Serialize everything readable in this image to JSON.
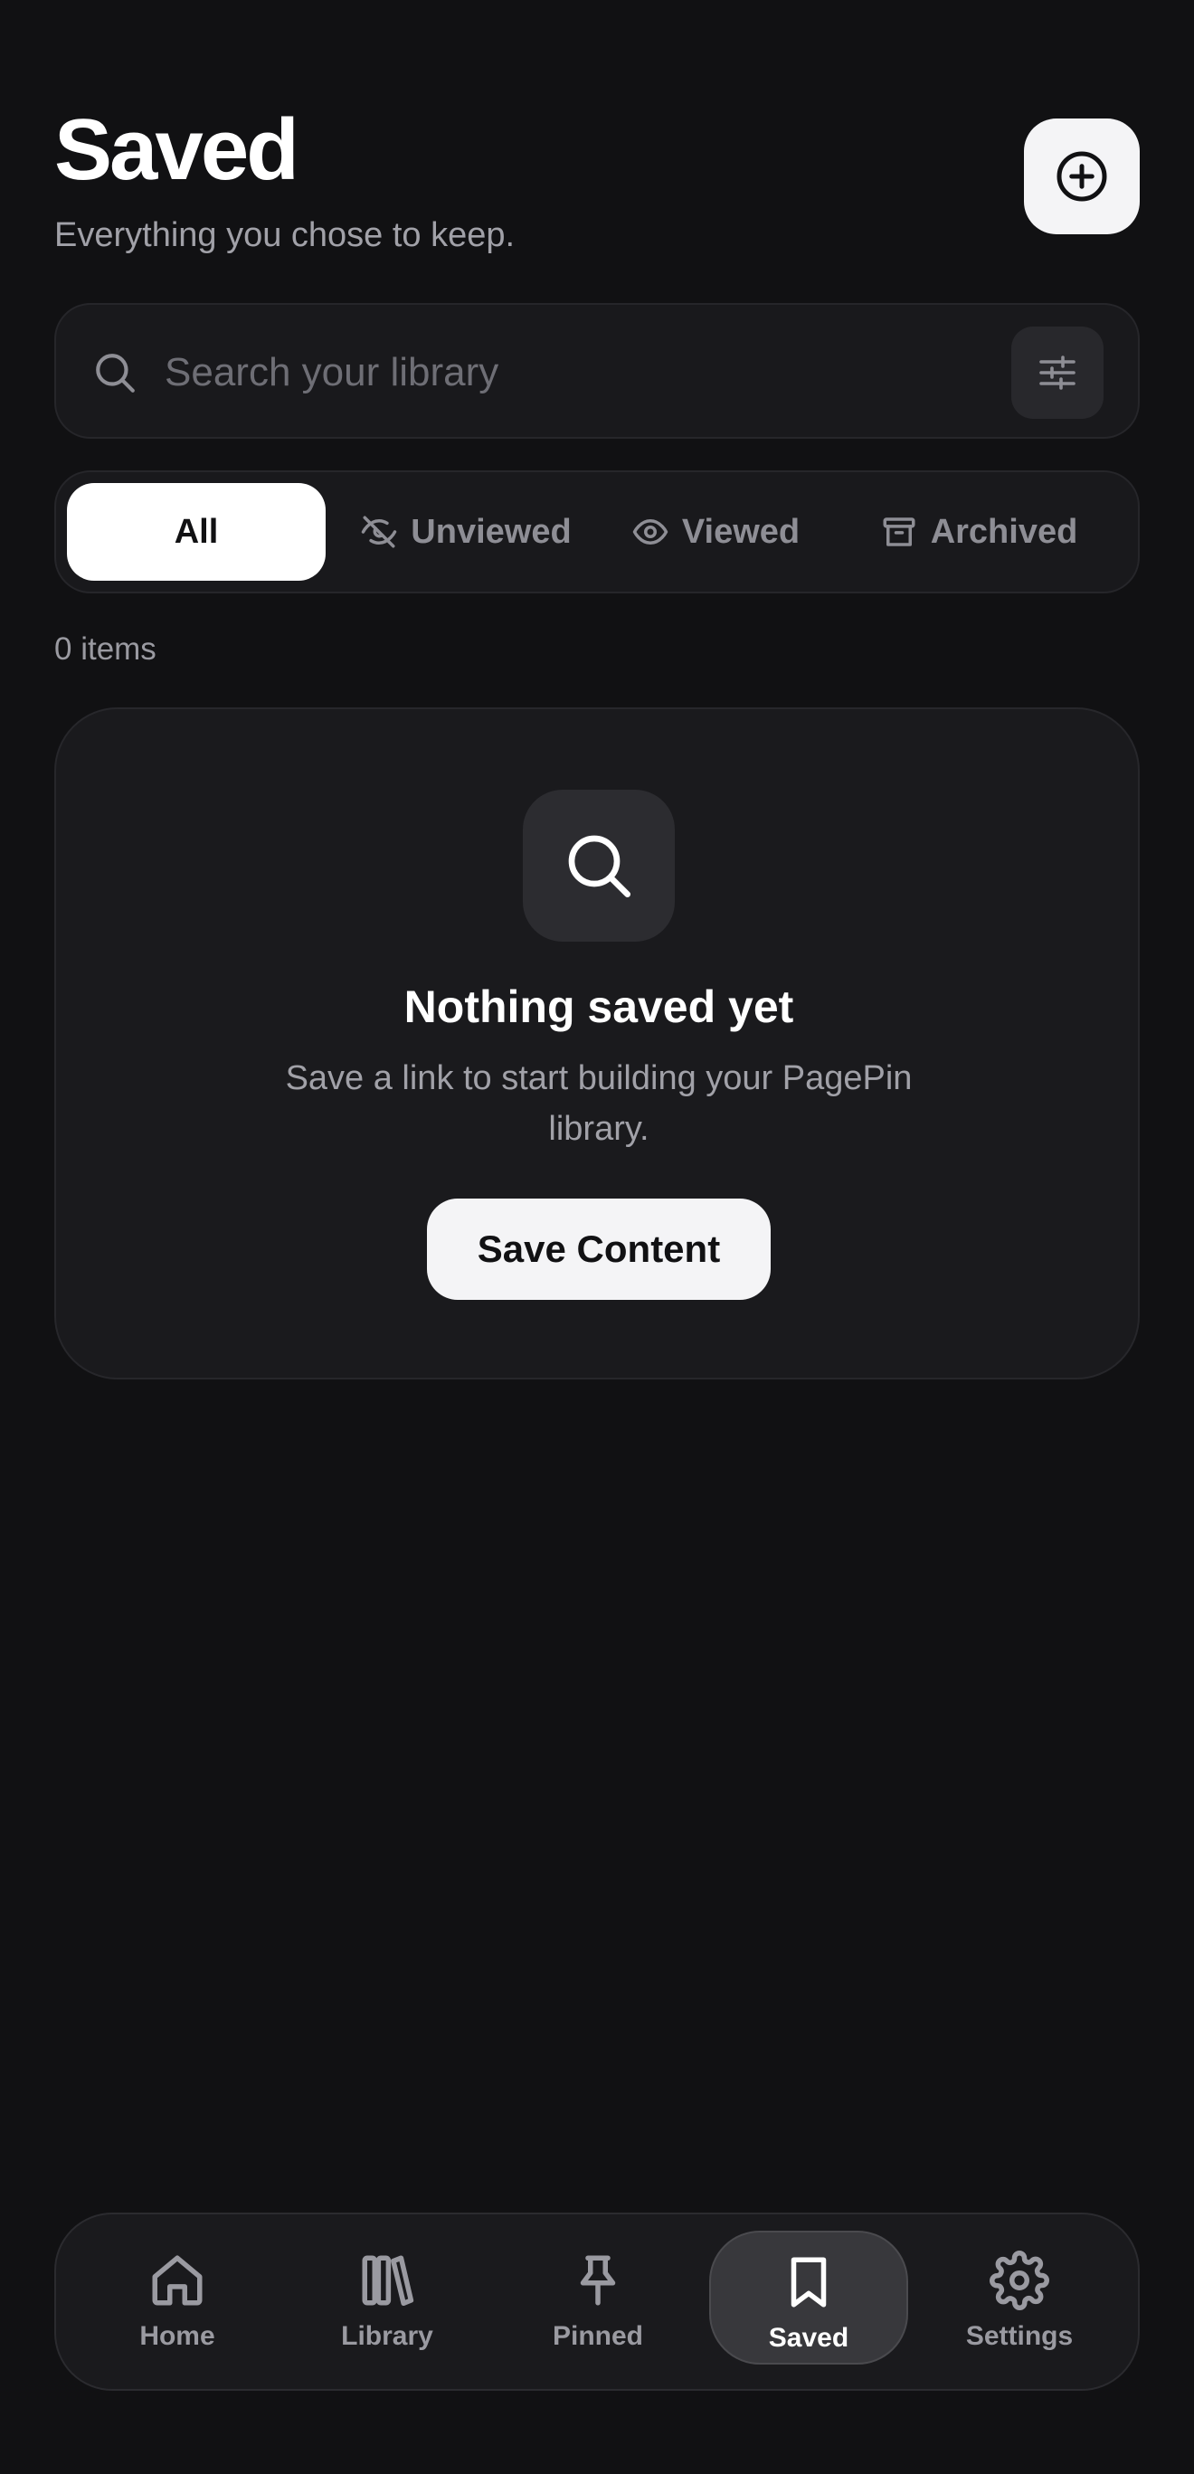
{
  "header": {
    "title": "Saved",
    "subtitle": "Everything you chose to keep.",
    "add_icon": "plus-circle-icon"
  },
  "search": {
    "placeholder": "Search your library",
    "value": "",
    "search_icon": "search-icon",
    "filter_icon": "sliders-icon"
  },
  "tabs": [
    {
      "label": "All",
      "icon": "",
      "active": true
    },
    {
      "label": "Unviewed",
      "icon": "eye-off-icon",
      "active": false
    },
    {
      "label": "Viewed",
      "icon": "eye-icon",
      "active": false
    },
    {
      "label": "Archived",
      "icon": "archive-icon",
      "active": false
    }
  ],
  "items_count": "0 items",
  "empty_state": {
    "icon": "search-icon",
    "title": "Nothing saved yet",
    "text": "Save a link to start building your PagePin library.",
    "button_label": "Save Content"
  },
  "nav": {
    "items": [
      {
        "label": "Home",
        "icon": "home-icon",
        "active": false
      },
      {
        "label": "Library",
        "icon": "library-icon",
        "active": false
      },
      {
        "label": "Pinned",
        "icon": "pin-icon",
        "active": false
      },
      {
        "label": "Saved",
        "icon": "bookmark-icon",
        "active": true
      },
      {
        "label": "Settings",
        "icon": "gear-icon",
        "active": false
      }
    ]
  },
  "colors": {
    "background": "#111113",
    "surface": "#1a1a1d",
    "accent": "#ffffff",
    "muted_text": "#a1a1a8"
  }
}
